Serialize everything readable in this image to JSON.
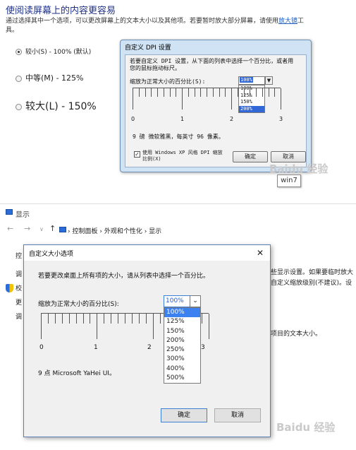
{
  "top": {
    "title": "使阅读屏幕上的内容更容易",
    "desc_before_link": "通过选择其中一个选项，可以更改屏幕上的文本大小以及其他项。若要暂时放大部分屏幕，请使用",
    "desc_link": "放大镜",
    "desc_after_link": "工具。",
    "options": [
      {
        "label": "较小(S) - 100% (默认)",
        "selected": true
      },
      {
        "label": "中等(M) - 125%",
        "selected": false
      },
      {
        "label": "较大(L) - 150%",
        "selected": false
      }
    ],
    "dialog": {
      "title": "自定义 DPI 设置",
      "instruction": "若要自定义 DPI 设置，从下面的列表中选择一个百分比，或者用您的鼠标拖动标尺。",
      "scale_label": "缩放为正常大小的百分比(S):",
      "combo_value": "100%",
      "list_options": [
        "100%",
        "125%",
        "150%",
        "200%"
      ],
      "highlighted_option": "200%",
      "ruler_labels": [
        "0",
        "1",
        "2",
        "3"
      ],
      "font_sample": "9 磅 微软雅黑，每英寸 96 像素。",
      "checkbox_label": "使用 Windows XP 风格 DPI 缩放比例(X)",
      "checkbox_checked": true,
      "ok_label": "确定",
      "cancel_label": "取消"
    },
    "win_tag": "win7",
    "watermark": "Baidu 经验"
  },
  "bottom": {
    "window_title": "显示",
    "breadcrumb": [
      "控制面板",
      "外观和个性化",
      "显示"
    ],
    "background": {
      "line1": "控",
      "line2": "调",
      "line3": "校",
      "line4": "更",
      "line5": "调",
      "link1": "些显示设置",
      "text1": "。如果要临时放大",
      "link2": "自定义缩放级别",
      "text2": "(不建议)。设",
      "text3": "项目的文本大小。"
    },
    "dialog": {
      "title": "自定义大小选项",
      "close_glyph": "✕",
      "instruction": "若要更改桌面上所有项的大小，请从列表中选择一个百分比。",
      "scale_label": "缩放为正常大小的百分比(S):",
      "combo_value": "100%",
      "list_options": [
        "100%",
        "125%",
        "150%",
        "200%",
        "250%",
        "300%",
        "400%",
        "500%"
      ],
      "highlighted_option": "100%",
      "ruler_labels": [
        "0",
        "1",
        "2",
        "3"
      ],
      "font_sample": "9 点 Microsoft YaHei UI。",
      "ok_label": "确定",
      "cancel_label": "取消"
    },
    "watermark": "Baidu 经验"
  }
}
